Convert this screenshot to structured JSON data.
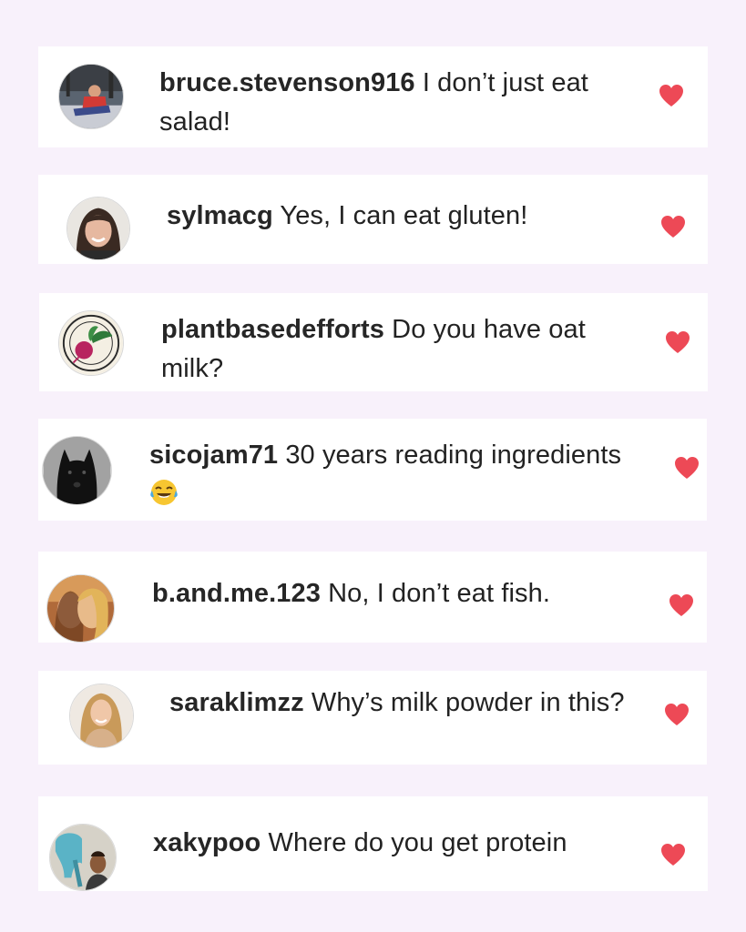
{
  "colors": {
    "background": "#f8f1fb",
    "card": "#ffffff",
    "heart": "#ed4956",
    "text": "#222222"
  },
  "comments": [
    {
      "username": "bruce.stevenson916",
      "text": " I don’t just eat salad!",
      "avatar_icon": "person-in-red-jacket-avatar",
      "liked": true
    },
    {
      "username": "sylmacg",
      "text": " Yes, I can eat gluten!",
      "avatar_icon": "smiling-woman-avatar",
      "liked": true
    },
    {
      "username": "plantbasedefforts",
      "text": " Do you have oat milk?",
      "avatar_icon": "beet-logo-avatar",
      "avatar_logo_text": "PLANT-BASED EFFORTS",
      "liked": true
    },
    {
      "username": "sicojam71",
      "text": " 30 years reading ingredients ",
      "emoji": "face-with-tears-of-joy-emoji",
      "avatar_icon": "black-dog-avatar",
      "liked": true
    },
    {
      "username": "b.and.me.123",
      "text": " No, I don’t eat fish.",
      "avatar_icon": "two-people-avatar",
      "liked": true
    },
    {
      "username": "saraklimzz",
      "text": " Why’s milk powder in this?",
      "avatar_icon": "smiling-blonde-woman-avatar",
      "liked": true
    },
    {
      "username": "xakypoo",
      "text": " Where do you get protein",
      "avatar_icon": "man-with-elephant-avatar",
      "liked": true
    }
  ]
}
